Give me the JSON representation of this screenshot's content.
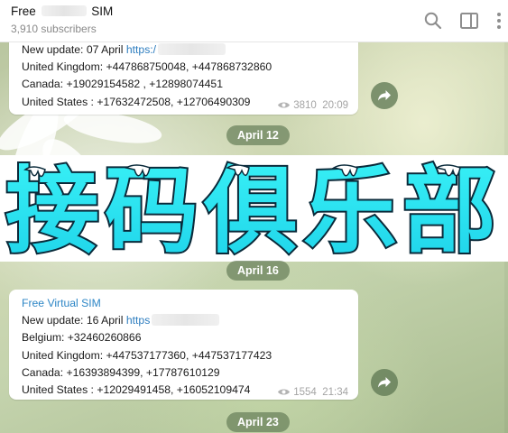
{
  "header": {
    "title_start": "Free",
    "title_end": "SIM",
    "subscribers": "3,910 subscribers",
    "icons": [
      "search-icon",
      "sidebar-toggle-icon",
      "more-vertical-icon"
    ]
  },
  "messages": [
    {
      "lines": [
        {
          "text": "New update: 07 April ",
          "link": "https:/"
        },
        {
          "text": "United Kingdom: +447868750048, +447868732860"
        },
        {
          "text": "Canada: +19029154582 , +12898074451"
        },
        {
          "text": "United States : +17632472508, +12706490309"
        }
      ],
      "views": "3810",
      "time": "20:09"
    },
    {
      "channel": "Free Virtual SIM",
      "lines": [
        {
          "text": "New update: 16 April ",
          "link": "https"
        },
        {
          "text": "Belgium: +32460260866"
        },
        {
          "text": "United Kingdom: +447537177360, +447537177423"
        },
        {
          "text": "Canada: +16393894399, +17787610129"
        },
        {
          "text": "United States : +12029491458, +16052109474"
        }
      ],
      "views": "1554",
      "time": "21:34"
    }
  ],
  "dates": [
    "April 12",
    "April 16",
    "April 23"
  ],
  "watermark": {
    "text": "接码俱乐部",
    "colors": {
      "fill": "#2ee6f0",
      "outline": "#0a2a3a",
      "frost": "#ffffff"
    }
  },
  "colors": {
    "link": "#2d7dbf",
    "channel_name": "#2d86c6",
    "date_pill": "#68805a",
    "share_button": "#607a54"
  }
}
